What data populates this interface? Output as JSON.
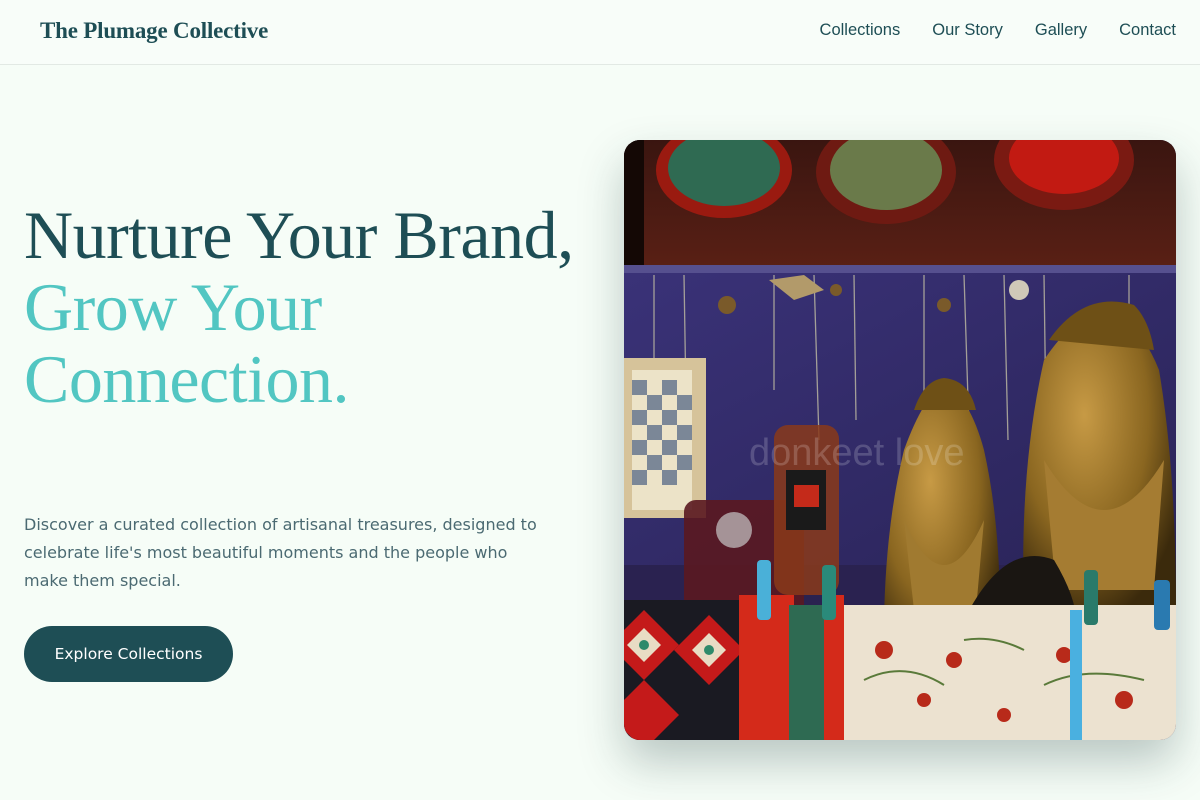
{
  "header": {
    "brand": "The Plumage Collective",
    "nav": [
      "Collections",
      "Our Story",
      "Gallery",
      "Contact"
    ]
  },
  "hero": {
    "title_line1": "Nurture Your Brand,",
    "title_line2": "Grow Your Connection.",
    "description": "Discover a curated collection of artisanal treasures, designed to celebrate life's most beautiful moments and the people who make them special.",
    "cta_label": "Explore Collections",
    "image_watermark": "donkeet love"
  },
  "colors": {
    "primary": "#1e4e55",
    "accent": "#52c6c2",
    "background": "#f6fdf7",
    "body_text": "#4b6a72"
  }
}
